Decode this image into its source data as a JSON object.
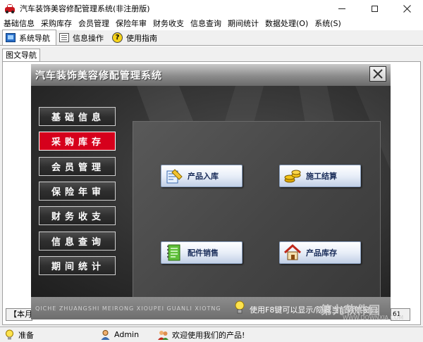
{
  "window": {
    "title": "汽车装饰美容修配管理系统(非注册版)"
  },
  "menubar": {
    "items": [
      "基础信息",
      "采购库存",
      "会员管理",
      "保险年审",
      "财务收支",
      "信息查询",
      "期间统计",
      "数据处理(O)",
      "系统(S)"
    ]
  },
  "toolbar": {
    "tabs": [
      {
        "label": "系统导航",
        "icon": "monitor-icon"
      },
      {
        "label": "信息操作",
        "icon": "document-icon"
      },
      {
        "label": "使用指南",
        "icon": "help-icon"
      }
    ]
  },
  "subtab": {
    "label": "图文导航"
  },
  "nav_window": {
    "title": "汽车装饰美容修配管理系统",
    "side_buttons": [
      {
        "label": "基础信息",
        "selected": false
      },
      {
        "label": "采购库存",
        "selected": true
      },
      {
        "label": "会员管理",
        "selected": false
      },
      {
        "label": "保险年审",
        "selected": false
      },
      {
        "label": "财务收支",
        "selected": false
      },
      {
        "label": "信息查询",
        "selected": false
      },
      {
        "label": "期间统计",
        "selected": false
      }
    ],
    "actions": [
      {
        "label": "产品入库",
        "icon": "stock-in-icon"
      },
      {
        "label": "施工结算",
        "icon": "coins-icon"
      },
      {
        "label": "配件销售",
        "icon": "notebook-icon"
      },
      {
        "label": "产品库存",
        "icon": "house-icon"
      }
    ],
    "footer_pinyin": "QICHE ZHUANGSHI MEIRONG XIOUPEI GUANLI XIOTNG",
    "tip": "使用F8键可以显示/隐藏当前导航窗口"
  },
  "background_strip": {
    "left_text": "【本月",
    "right_text": "61"
  },
  "watermark": {
    "text": "第九软件园",
    "url": "WWW.DOWNXIA.COM"
  },
  "statusbar": {
    "ready": "准备",
    "user": "Admin",
    "welcome": "欢迎使用我们的产品!"
  },
  "colors": {
    "selected_button": "#d6001c",
    "panel_dark": "#2c2c2c",
    "action_text": "#1a2d5a"
  }
}
